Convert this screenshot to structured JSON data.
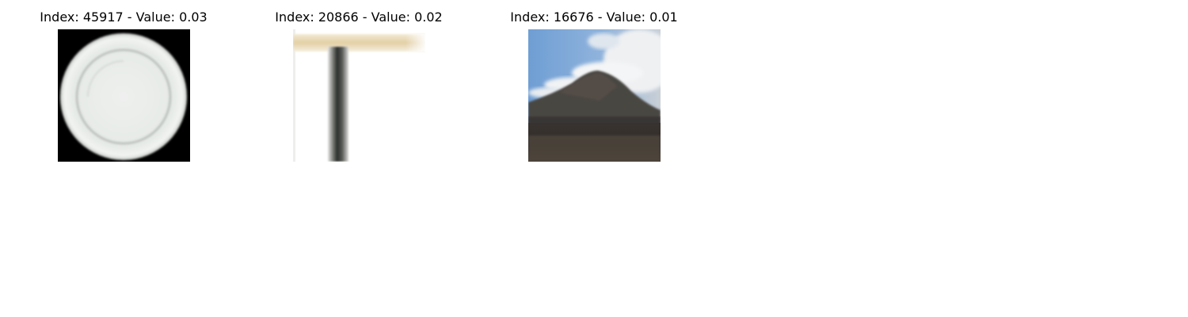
{
  "panels": [
    {
      "title": "Index: 45917 - Value: 0.03",
      "subject": "white-plate"
    },
    {
      "title": "Index: 20866 - Value: 0.02",
      "subject": "table-leg"
    },
    {
      "title": "Index: 16676 - Value: 0.01",
      "subject": "volcano-landscape"
    }
  ]
}
